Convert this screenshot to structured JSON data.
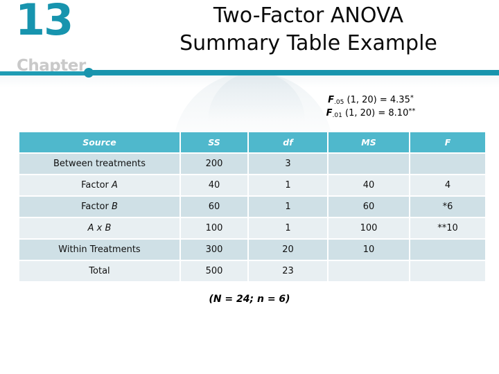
{
  "chapter": {
    "number": "13",
    "word": "Chapter",
    "accent_color": "#1894ad",
    "number_color": "#1794ae",
    "word_color": "#c9c9c9"
  },
  "title": {
    "line1": "Two-Factor ANOVA",
    "line2": "Summary Table Example"
  },
  "f_critical": {
    "line1_symbol": "F",
    "line1_subscript": ".05",
    "line1_rest": "(1, 20) = 4.35",
    "line1_stars": "*",
    "line2_symbol": "F",
    "line2_subscript": ".01",
    "line2_rest": "(1, 20) = 8.10",
    "line2_stars": "**"
  },
  "table": {
    "header_background": "#4fb8cc",
    "row_band_dark": "#cfe0e6",
    "row_band_light": "#e8eff2",
    "columns": [
      "Source",
      "SS",
      "df",
      "MS",
      "F"
    ],
    "rows": [
      {
        "source_plain": "Between treatments",
        "source_italic": "",
        "indent": 0,
        "ss": "200",
        "df": "3",
        "ms": "",
        "f": ""
      },
      {
        "source_plain": "Factor ",
        "source_italic": "A",
        "indent": 1,
        "ss": "40",
        "df": "1",
        "ms": "40",
        "f": "4"
      },
      {
        "source_plain": "Factor ",
        "source_italic": "B",
        "indent": 1,
        "ss": "60",
        "df": "1",
        "ms": "60",
        "f": "*6"
      },
      {
        "source_plain": "",
        "source_italic": "A x B",
        "indent": 2,
        "ss": "100",
        "df": "1",
        "ms": "100",
        "f": "**10"
      },
      {
        "source_plain": "Within Treatments",
        "source_italic": "",
        "indent": 0,
        "ss": "300",
        "df": "20",
        "ms": "10",
        "f": ""
      },
      {
        "source_plain": "Total",
        "source_italic": "",
        "indent": 0,
        "ss": "500",
        "df": "23",
        "ms": "",
        "f": ""
      }
    ]
  },
  "footer": {
    "note_open": "(",
    "n_big": "N",
    "n_big_value": " = 24; ",
    "n_small": "n",
    "n_small_value": " = 6)"
  }
}
